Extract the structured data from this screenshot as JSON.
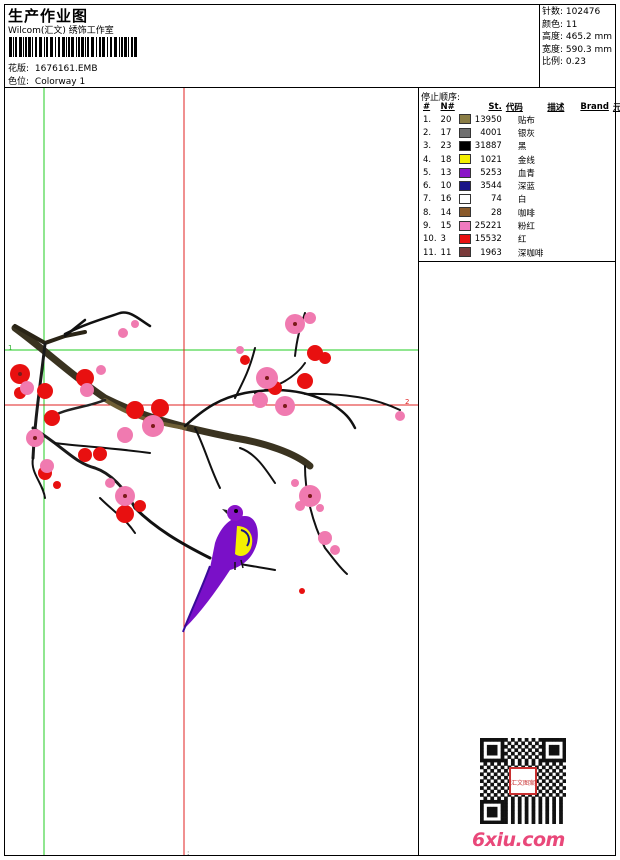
{
  "header": {
    "title": "生产作业图",
    "studio": "Wilcom(汇文) 绣饰工作室",
    "design_label": "花版:",
    "design_file": "1676161.EMB",
    "colorway_label": "色位:",
    "colorway": "Colorway 1"
  },
  "stats": {
    "stitches": "针数: 102476",
    "colors": "颜色: 11",
    "height": "高度: 465.2 mm",
    "width": "宽度: 590.3 mm",
    "scale": "比例: 0.23"
  },
  "sequence": {
    "heading": "停止顺序:",
    "columns": {
      "idx": "#",
      "no": "N#",
      "st": "St.",
      "code": "代码",
      "desc": "描述",
      "brand": "Brand",
      "element": "元素"
    },
    "rows": [
      {
        "idx": "1.",
        "no": "20",
        "code": "13950",
        "desc": "贴布",
        "color": "#8a7d45"
      },
      {
        "idx": "2.",
        "no": "17",
        "code": "4001",
        "desc": "银灰",
        "color": "#707070"
      },
      {
        "idx": "3.",
        "no": "23",
        "code": "31887",
        "desc": "黑",
        "color": "#000000"
      },
      {
        "idx": "4.",
        "no": "18",
        "code": "1021",
        "desc": "金线",
        "color": "#f4f000"
      },
      {
        "idx": "5.",
        "no": "13",
        "code": "5253",
        "desc": "血青",
        "color": "#8a14c8"
      },
      {
        "idx": "6.",
        "no": "10",
        "code": "3544",
        "desc": "深蓝",
        "color": "#1a1488"
      },
      {
        "idx": "7.",
        "no": "16",
        "code": "74",
        "desc": "白",
        "color": "#ffffff"
      },
      {
        "idx": "8.",
        "no": "14",
        "code": "28",
        "desc": "咖啡",
        "color": "#8a5a2a"
      },
      {
        "idx": "9.",
        "no": "15",
        "code": "25221",
        "desc": "粉红",
        "color": "#f07ac0"
      },
      {
        "idx": "10.",
        "no": "3",
        "code": "15532",
        "desc": "红",
        "color": "#e81010"
      },
      {
        "idx": "11.",
        "no": "11",
        "code": "1963",
        "desc": "深咖啡",
        "color": "#7a3a3a"
      }
    ]
  },
  "guides": {
    "marker_1": "1",
    "marker_2": "2"
  },
  "watermark": {
    "site": "6xiu.com",
    "stamp": "汇文图案"
  }
}
